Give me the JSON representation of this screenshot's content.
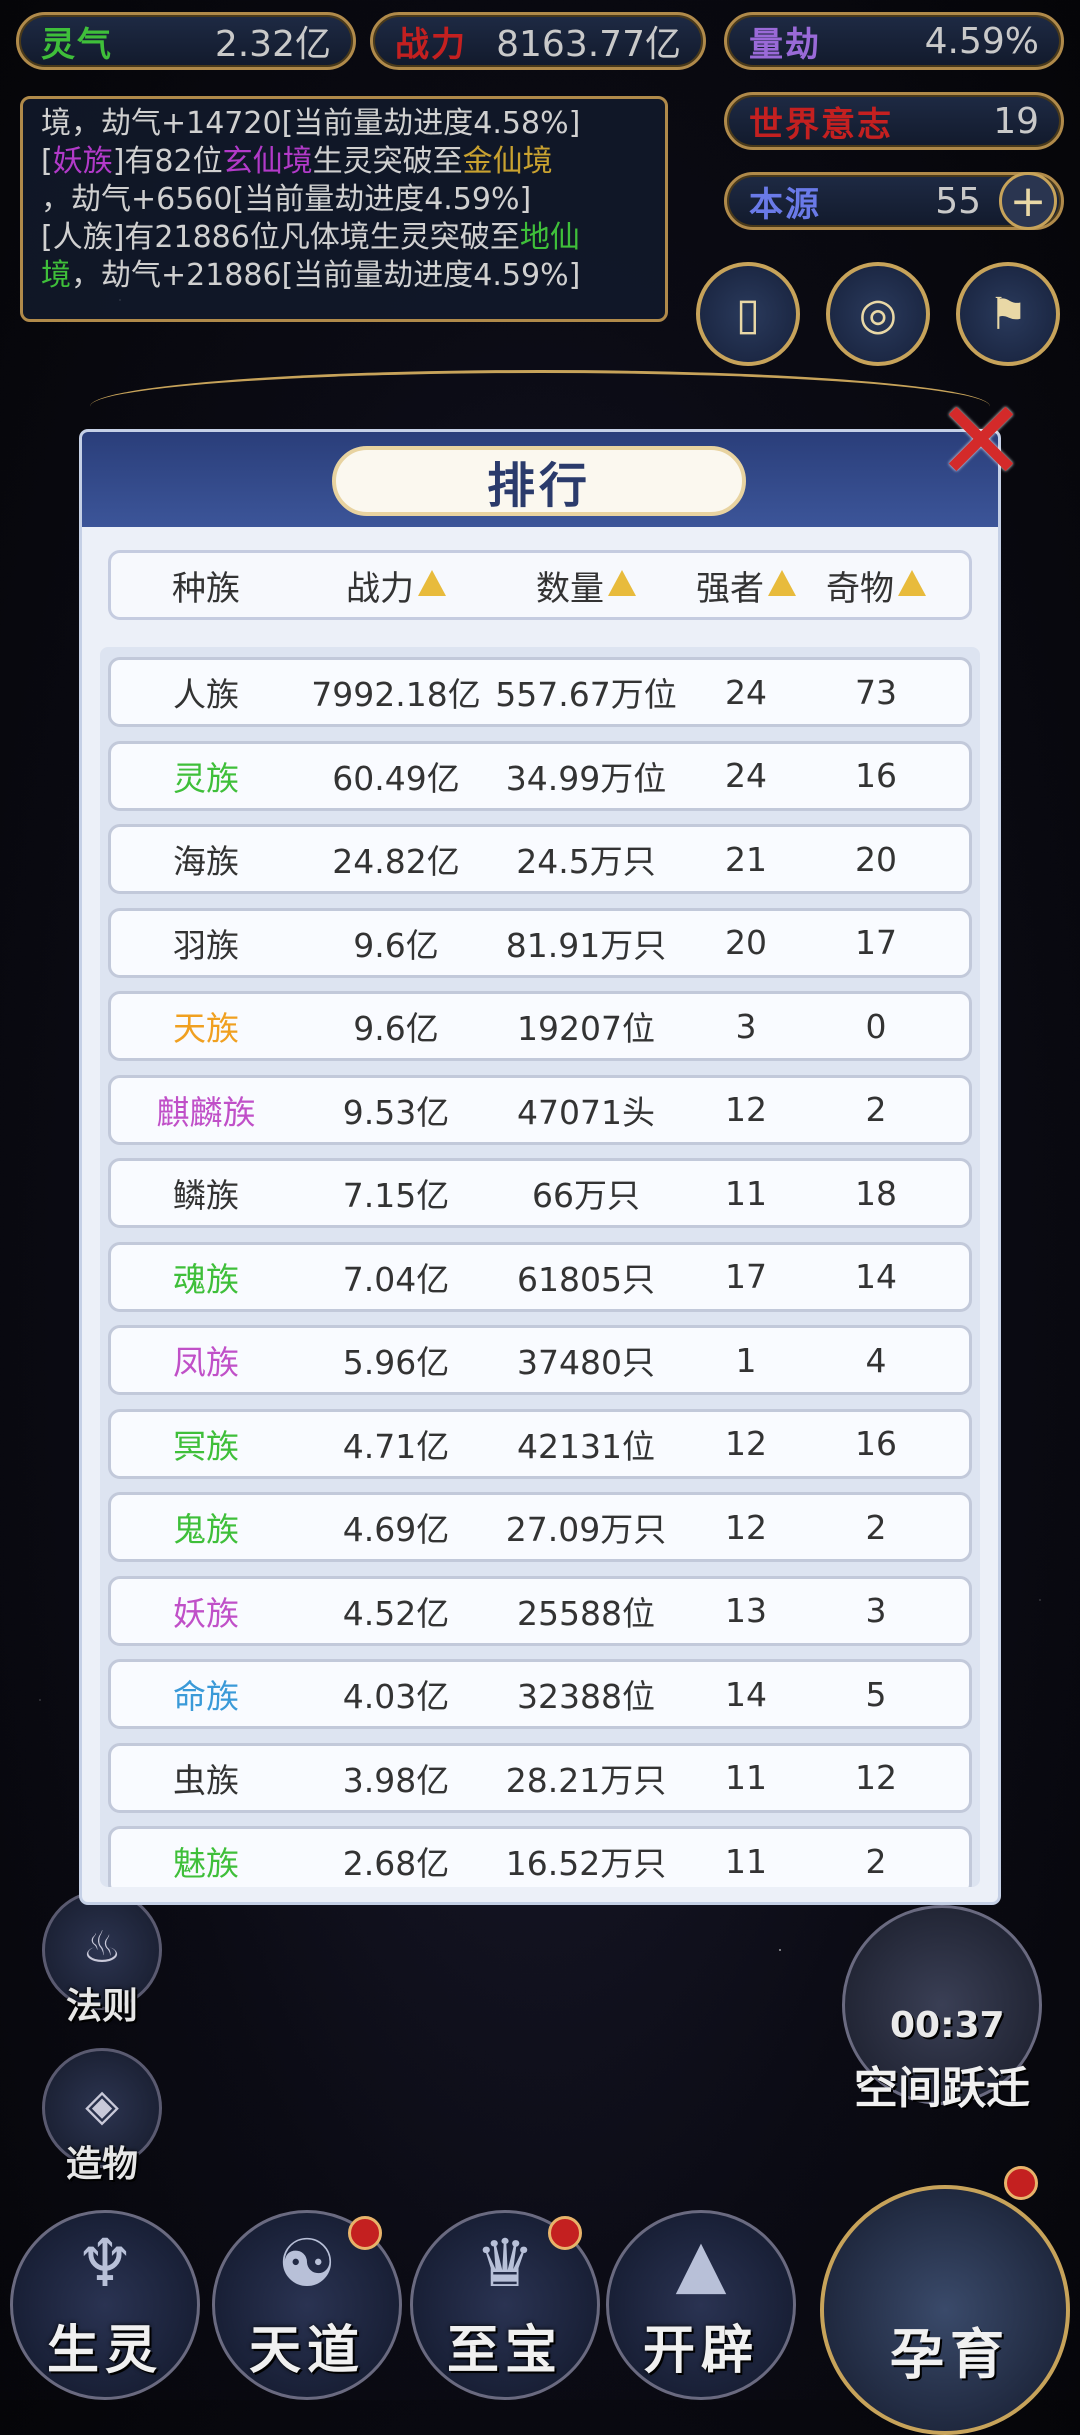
{
  "stats": {
    "lingqi": {
      "label": "灵气",
      "value": "2.32亿"
    },
    "zhanli": {
      "label": "战力",
      "value": "8163.77亿"
    },
    "liangjie": {
      "label": "量劫",
      "value": "4.59%"
    },
    "shijie": {
      "label": "世界意志",
      "value": "19"
    },
    "benyuan": {
      "label": "本源",
      "value": "55"
    }
  },
  "log": {
    "line1": "境，劫气+14720[当前量劫进度4.58%]",
    "line2_a": "[",
    "line2_race": "妖族",
    "line2_b": "]有82位",
    "line2_realm1": "玄仙境",
    "line2_c": "生灵突破至",
    "line2_realm2": "金仙境",
    "line3": "，劫气+6560[当前量劫进度4.59%]",
    "line4_a": "[人族]有21886位凡体境生灵突破至",
    "line4_realm": "地仙",
    "line5_realm": "境",
    "line5_b": "，劫气+21886[当前量劫进度4.59%]"
  },
  "ranking": {
    "title": "排行",
    "columns": [
      "种族",
      "战力",
      "数量",
      "强者",
      "奇物"
    ],
    "rows": [
      {
        "race": "人族",
        "power": "7992.18亿",
        "count": "557.67万位",
        "strong": "24",
        "treasure": "73",
        "color": "#333333"
      },
      {
        "race": "灵族",
        "power": "60.49亿",
        "count": "34.99万位",
        "strong": "24",
        "treasure": "16",
        "color": "#3fbf3a"
      },
      {
        "race": "海族",
        "power": "24.82亿",
        "count": "24.5万只",
        "strong": "21",
        "treasure": "20",
        "color": "#333333"
      },
      {
        "race": "羽族",
        "power": "9.6亿",
        "count": "81.91万只",
        "strong": "20",
        "treasure": "17",
        "color": "#333333"
      },
      {
        "race": "天族",
        "power": "9.6亿",
        "count": "19207位",
        "strong": "3",
        "treasure": "0",
        "color": "#f0a020"
      },
      {
        "race": "麒麟族",
        "power": "9.53亿",
        "count": "47071头",
        "strong": "12",
        "treasure": "2",
        "color": "#c050c8"
      },
      {
        "race": "鳞族",
        "power": "7.15亿",
        "count": "66万只",
        "strong": "11",
        "treasure": "18",
        "color": "#333333"
      },
      {
        "race": "魂族",
        "power": "7.04亿",
        "count": "61805只",
        "strong": "17",
        "treasure": "14",
        "color": "#3fbf3a"
      },
      {
        "race": "凤族",
        "power": "5.96亿",
        "count": "37480只",
        "strong": "1",
        "treasure": "4",
        "color": "#c050c8"
      },
      {
        "race": "冥族",
        "power": "4.71亿",
        "count": "42131位",
        "strong": "12",
        "treasure": "16",
        "color": "#3fbf3a"
      },
      {
        "race": "鬼族",
        "power": "4.69亿",
        "count": "27.09万只",
        "strong": "12",
        "treasure": "2",
        "color": "#3fbf3a"
      },
      {
        "race": "妖族",
        "power": "4.52亿",
        "count": "25588位",
        "strong": "13",
        "treasure": "3",
        "color": "#c050c8"
      },
      {
        "race": "命族",
        "power": "4.03亿",
        "count": "32388位",
        "strong": "14",
        "treasure": "5",
        "color": "#3a9ad8"
      },
      {
        "race": "虫族",
        "power": "3.98亿",
        "count": "28.21万只",
        "strong": "11",
        "treasure": "12",
        "color": "#333333"
      },
      {
        "race": "魅族",
        "power": "2.68亿",
        "count": "16.52万只",
        "strong": "11",
        "treasure": "2",
        "color": "#3fbf3a"
      }
    ]
  },
  "side_left": {
    "fazhe": "法则",
    "zaowu": "造物"
  },
  "side_right": {
    "timer": "00:37",
    "kongjian": "空间跃迁"
  },
  "bottom_nav": [
    "生灵",
    "天道",
    "至宝",
    "开辟"
  ],
  "yunyu": "孕育",
  "close": "✕"
}
